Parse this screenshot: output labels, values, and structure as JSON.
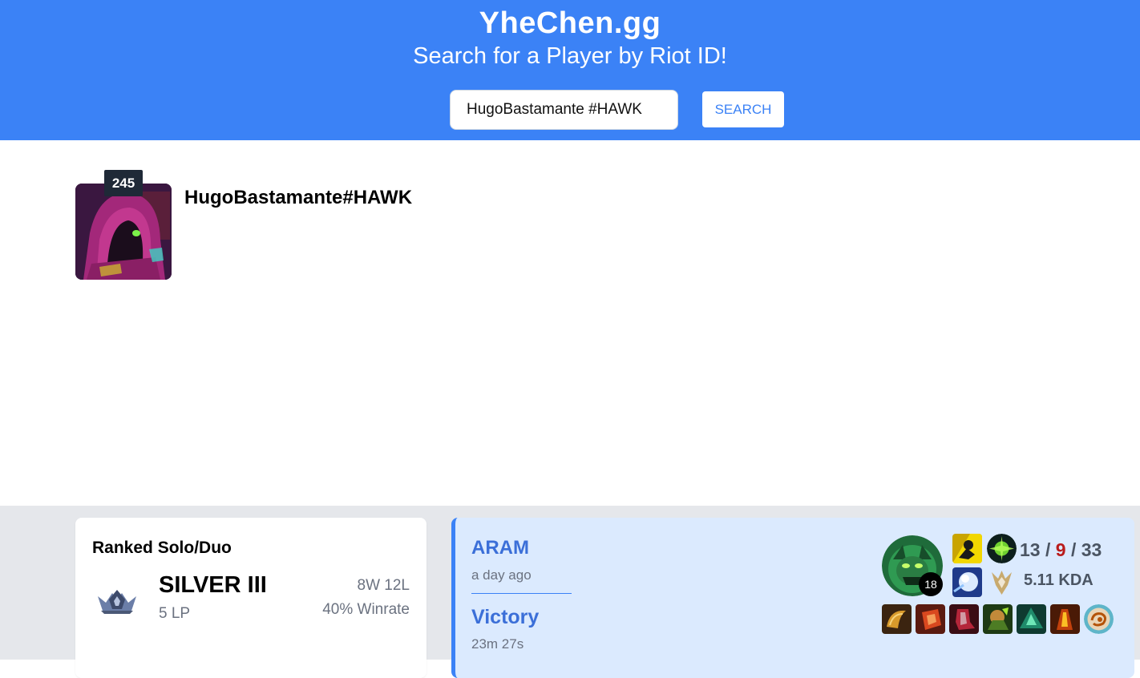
{
  "header": {
    "site_title": "YheChen.gg",
    "subtitle": "Search for a Player by Riot ID!",
    "search_value": "HugoBastamante #HAWK",
    "search_button": "SEARCH"
  },
  "profile": {
    "level": "245",
    "name": "HugoBastamante#HAWK",
    "avatar_icon": "hooded-figure-profile-icon"
  },
  "ranked": {
    "title": "Ranked Solo/Duo",
    "tier": "SILVER III",
    "lp": "5 LP",
    "wins_losses": "8W 12L",
    "winrate": "40% Winrate",
    "emblem_icon": "silver-rank-emblem-icon"
  },
  "match": {
    "mode": "ARAM",
    "time_ago": "a day ago",
    "result": "Victory",
    "duration": "23m 27s",
    "champion_level": "18",
    "kills": "13",
    "deaths": "9",
    "assists": "33",
    "kda": "5.11 KDA",
    "champion_icon": "champion-portrait-icon",
    "spells": [
      "flash-spell-icon",
      "mark-snowball-spell-icon"
    ],
    "runes": [
      "primary-rune-icon",
      "secondary-rune-tree-icon"
    ],
    "items": [
      "item-1-icon",
      "item-2-icon",
      "item-3-icon",
      "item-4-icon",
      "item-5-icon",
      "item-6-icon",
      "trinket-icon"
    ]
  },
  "colors": {
    "header_bg": "#3b82f6",
    "victory_blue": "#3b6fd8",
    "match_bg": "#dbeafe",
    "deaths_red": "#b91c1c"
  }
}
